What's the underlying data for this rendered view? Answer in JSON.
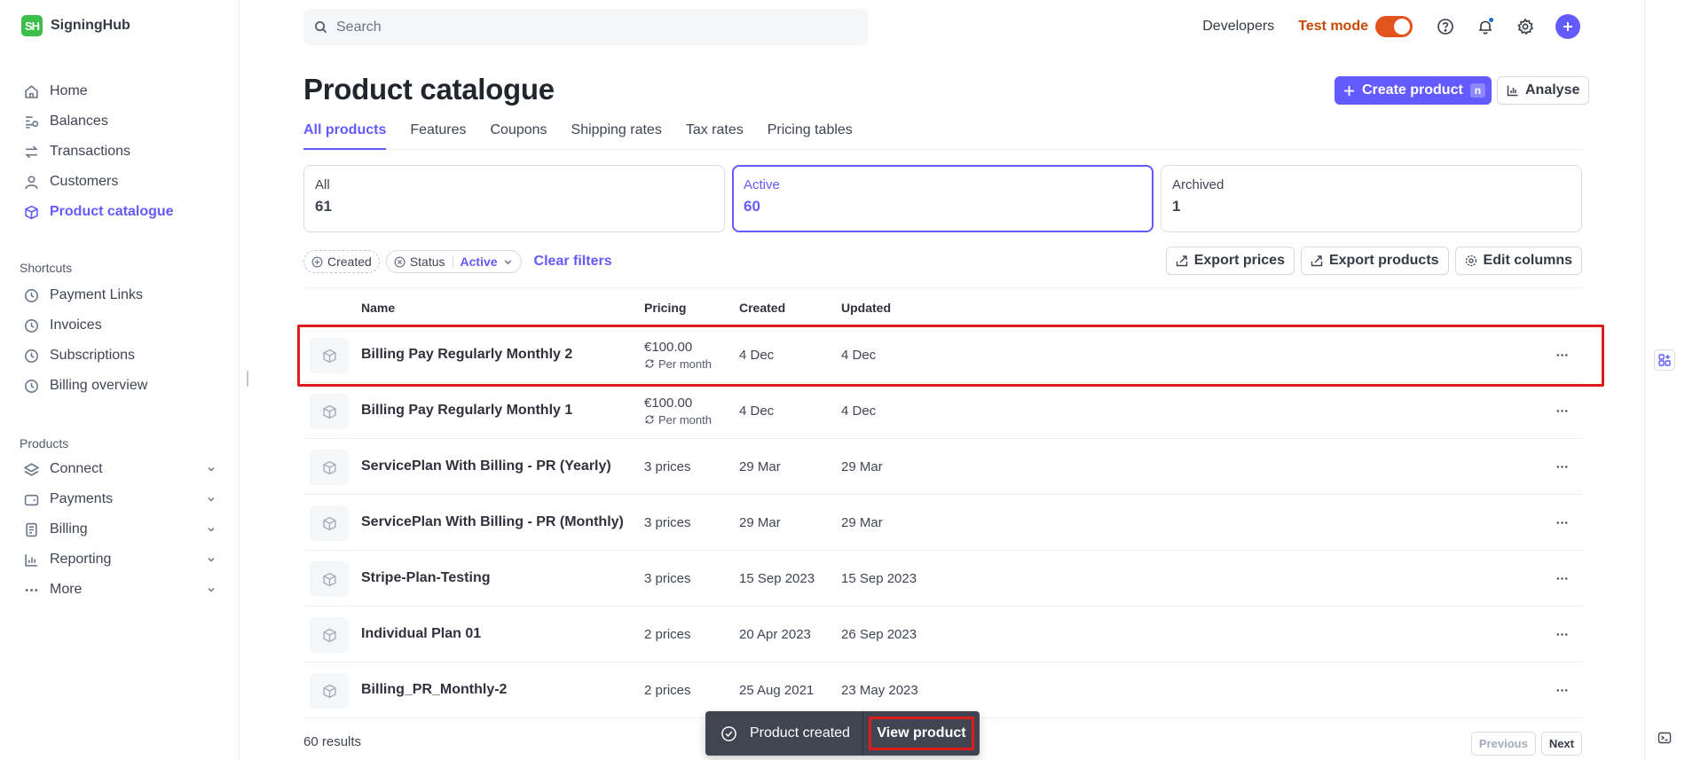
{
  "brand": {
    "logo_text": "SH",
    "name": "SigningHub"
  },
  "sidebar": {
    "main_items": [
      {
        "label": "Home",
        "icon": "home-icon"
      },
      {
        "label": "Balances",
        "icon": "balances-icon"
      },
      {
        "label": "Transactions",
        "icon": "transactions-icon"
      },
      {
        "label": "Customers",
        "icon": "customers-icon"
      },
      {
        "label": "Product catalogue",
        "icon": "product-icon",
        "active": true
      }
    ],
    "shortcuts_title": "Shortcuts",
    "shortcuts": [
      {
        "label": "Payment Links",
        "icon": "clock-icon"
      },
      {
        "label": "Invoices",
        "icon": "clock-icon"
      },
      {
        "label": "Subscriptions",
        "icon": "clock-icon"
      },
      {
        "label": "Billing overview",
        "icon": "clock-icon"
      }
    ],
    "products_title": "Products",
    "products": [
      {
        "label": "Connect",
        "icon": "connect-icon"
      },
      {
        "label": "Payments",
        "icon": "wallet-icon"
      },
      {
        "label": "Billing",
        "icon": "billing-icon"
      },
      {
        "label": "Reporting",
        "icon": "reporting-icon"
      },
      {
        "label": "More",
        "icon": "more-icon"
      }
    ]
  },
  "topbar": {
    "search_placeholder": "Search",
    "developers": "Developers",
    "test_mode": "Test mode",
    "test_mode_on": true
  },
  "page": {
    "title": "Product catalogue",
    "create_button": "Create product",
    "create_shortcut": "n",
    "analyse_button": "Analyse"
  },
  "tabs": [
    "All products",
    "Features",
    "Coupons",
    "Shipping rates",
    "Tax rates",
    "Pricing tables"
  ],
  "status_cards": [
    {
      "label": "All",
      "count": "61"
    },
    {
      "label": "Active",
      "count": "60",
      "active": true
    },
    {
      "label": "Archived",
      "count": "1"
    }
  ],
  "filters": {
    "created": "Created",
    "status": "Status",
    "status_value": "Active",
    "clear": "Clear filters"
  },
  "actions": {
    "export_prices": "Export prices",
    "export_products": "Export products",
    "edit_columns": "Edit columns"
  },
  "table": {
    "headers": {
      "name": "Name",
      "pricing": "Pricing",
      "created": "Created",
      "updated": "Updated"
    },
    "rows": [
      {
        "name": "Billing Pay Regularly Monthly 2",
        "price": "€100.00",
        "interval": "Per month",
        "created": "4 Dec",
        "updated": "4 Dec",
        "highlighted": true
      },
      {
        "name": "Billing Pay Regularly Monthly 1",
        "price": "€100.00",
        "interval": "Per month",
        "created": "4 Dec",
        "updated": "4 Dec"
      },
      {
        "name": "ServicePlan With Billing - PR (Yearly)",
        "price": "3 prices",
        "interval": "",
        "created": "29 Mar",
        "updated": "29 Mar"
      },
      {
        "name": "ServicePlan With Billing - PR (Monthly)",
        "price": "3 prices",
        "interval": "",
        "created": "29 Mar",
        "updated": "29 Mar"
      },
      {
        "name": "Stripe-Plan-Testing",
        "price": "3 prices",
        "interval": "",
        "created": "15 Sep 2023",
        "updated": "15 Sep 2023"
      },
      {
        "name": "Individual Plan 01",
        "price": "2 prices",
        "interval": "",
        "created": "20 Apr 2023",
        "updated": "26 Sep 2023"
      },
      {
        "name": "Billing_PR_Monthly-2",
        "price": "2 prices",
        "interval": "",
        "created": "25 Aug 2021",
        "updated": "23 May 2023"
      }
    ]
  },
  "footer": {
    "results": "60 results",
    "previous": "Previous",
    "next": "Next"
  },
  "toast": {
    "message": "Product created",
    "action": "View product"
  },
  "colors": {
    "accent": "#635bff",
    "test_mode": "#e3531b",
    "highlight": "#e01b1b",
    "toast_bg": "#414552"
  }
}
